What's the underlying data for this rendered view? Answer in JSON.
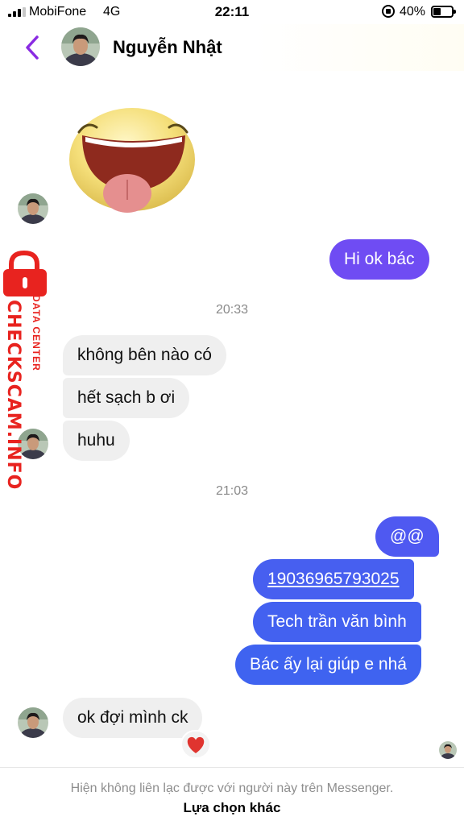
{
  "status_bar": {
    "carrier": "MobiFone",
    "network": "4G",
    "time": "22:11",
    "battery": "40%"
  },
  "header": {
    "contact_name": "Nguyễn Nhật",
    "back_icon": "chevron-left-icon"
  },
  "watermark": {
    "text": "CHECKSCAM.INFO",
    "subtext": "DATA CENTER",
    "color": "#e8231f"
  },
  "messages": {
    "sticker": "laughing-tongue-sticker",
    "out_1": "Hi ok bác",
    "time_1": "20:33",
    "in_1": "không bên nào có",
    "in_2": "hết sạch b ơi",
    "in_3": "huhu",
    "time_2": "21:03",
    "out_2": "@@",
    "out_3": "19036965793025",
    "out_4": "Tech trần văn bình",
    "out_5": "Bác ấy lại giúp e nhá",
    "in_4": "ok đợi mình ck",
    "reaction": "❤️"
  },
  "footer": {
    "notice": "Hiện không liên lạc được với người này trên Messenger.",
    "action": "Lựa chọn khác"
  },
  "colors": {
    "accent": "#7b2ff7",
    "out_gradient_top": "#6f4cf3",
    "out_gradient_bottom": "#3f63f0",
    "incoming_bubble": "#efefef"
  }
}
